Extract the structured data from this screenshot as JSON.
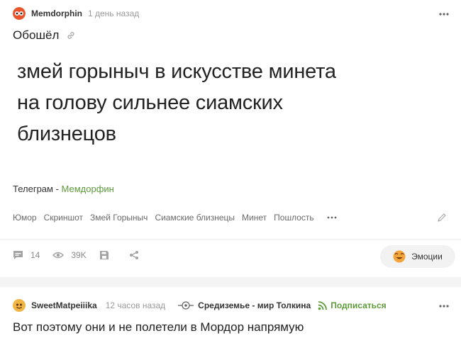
{
  "post": {
    "author": "Memdorphin",
    "time": "1 день назад",
    "title": "Обошёл",
    "image_text_lines": [
      "змей горыныч в искусстве минета",
      "на голову сильнее сиамских",
      "близнецов"
    ],
    "telegram_prefix": "Телеграм - ",
    "telegram_link": "Мемдорфин",
    "tags": [
      "Юмор",
      "Скриншот",
      "Змей Горыныч",
      "Сиамские близнецы",
      "Минет",
      "Пошлость"
    ],
    "comments_count": "14",
    "views_count": "39K",
    "emotions_label": "Эмоции"
  },
  "next_post": {
    "author": "SweetMatpeiiika",
    "time": "12 часов назад",
    "community": "Средиземье - мир Толкина",
    "subscribe_label": "Подписаться",
    "title": "Вот поэтому они и не полетели в Мордор напрямую"
  },
  "colors": {
    "accent_green": "#5c9a3a",
    "muted": "#8a8a8a"
  }
}
